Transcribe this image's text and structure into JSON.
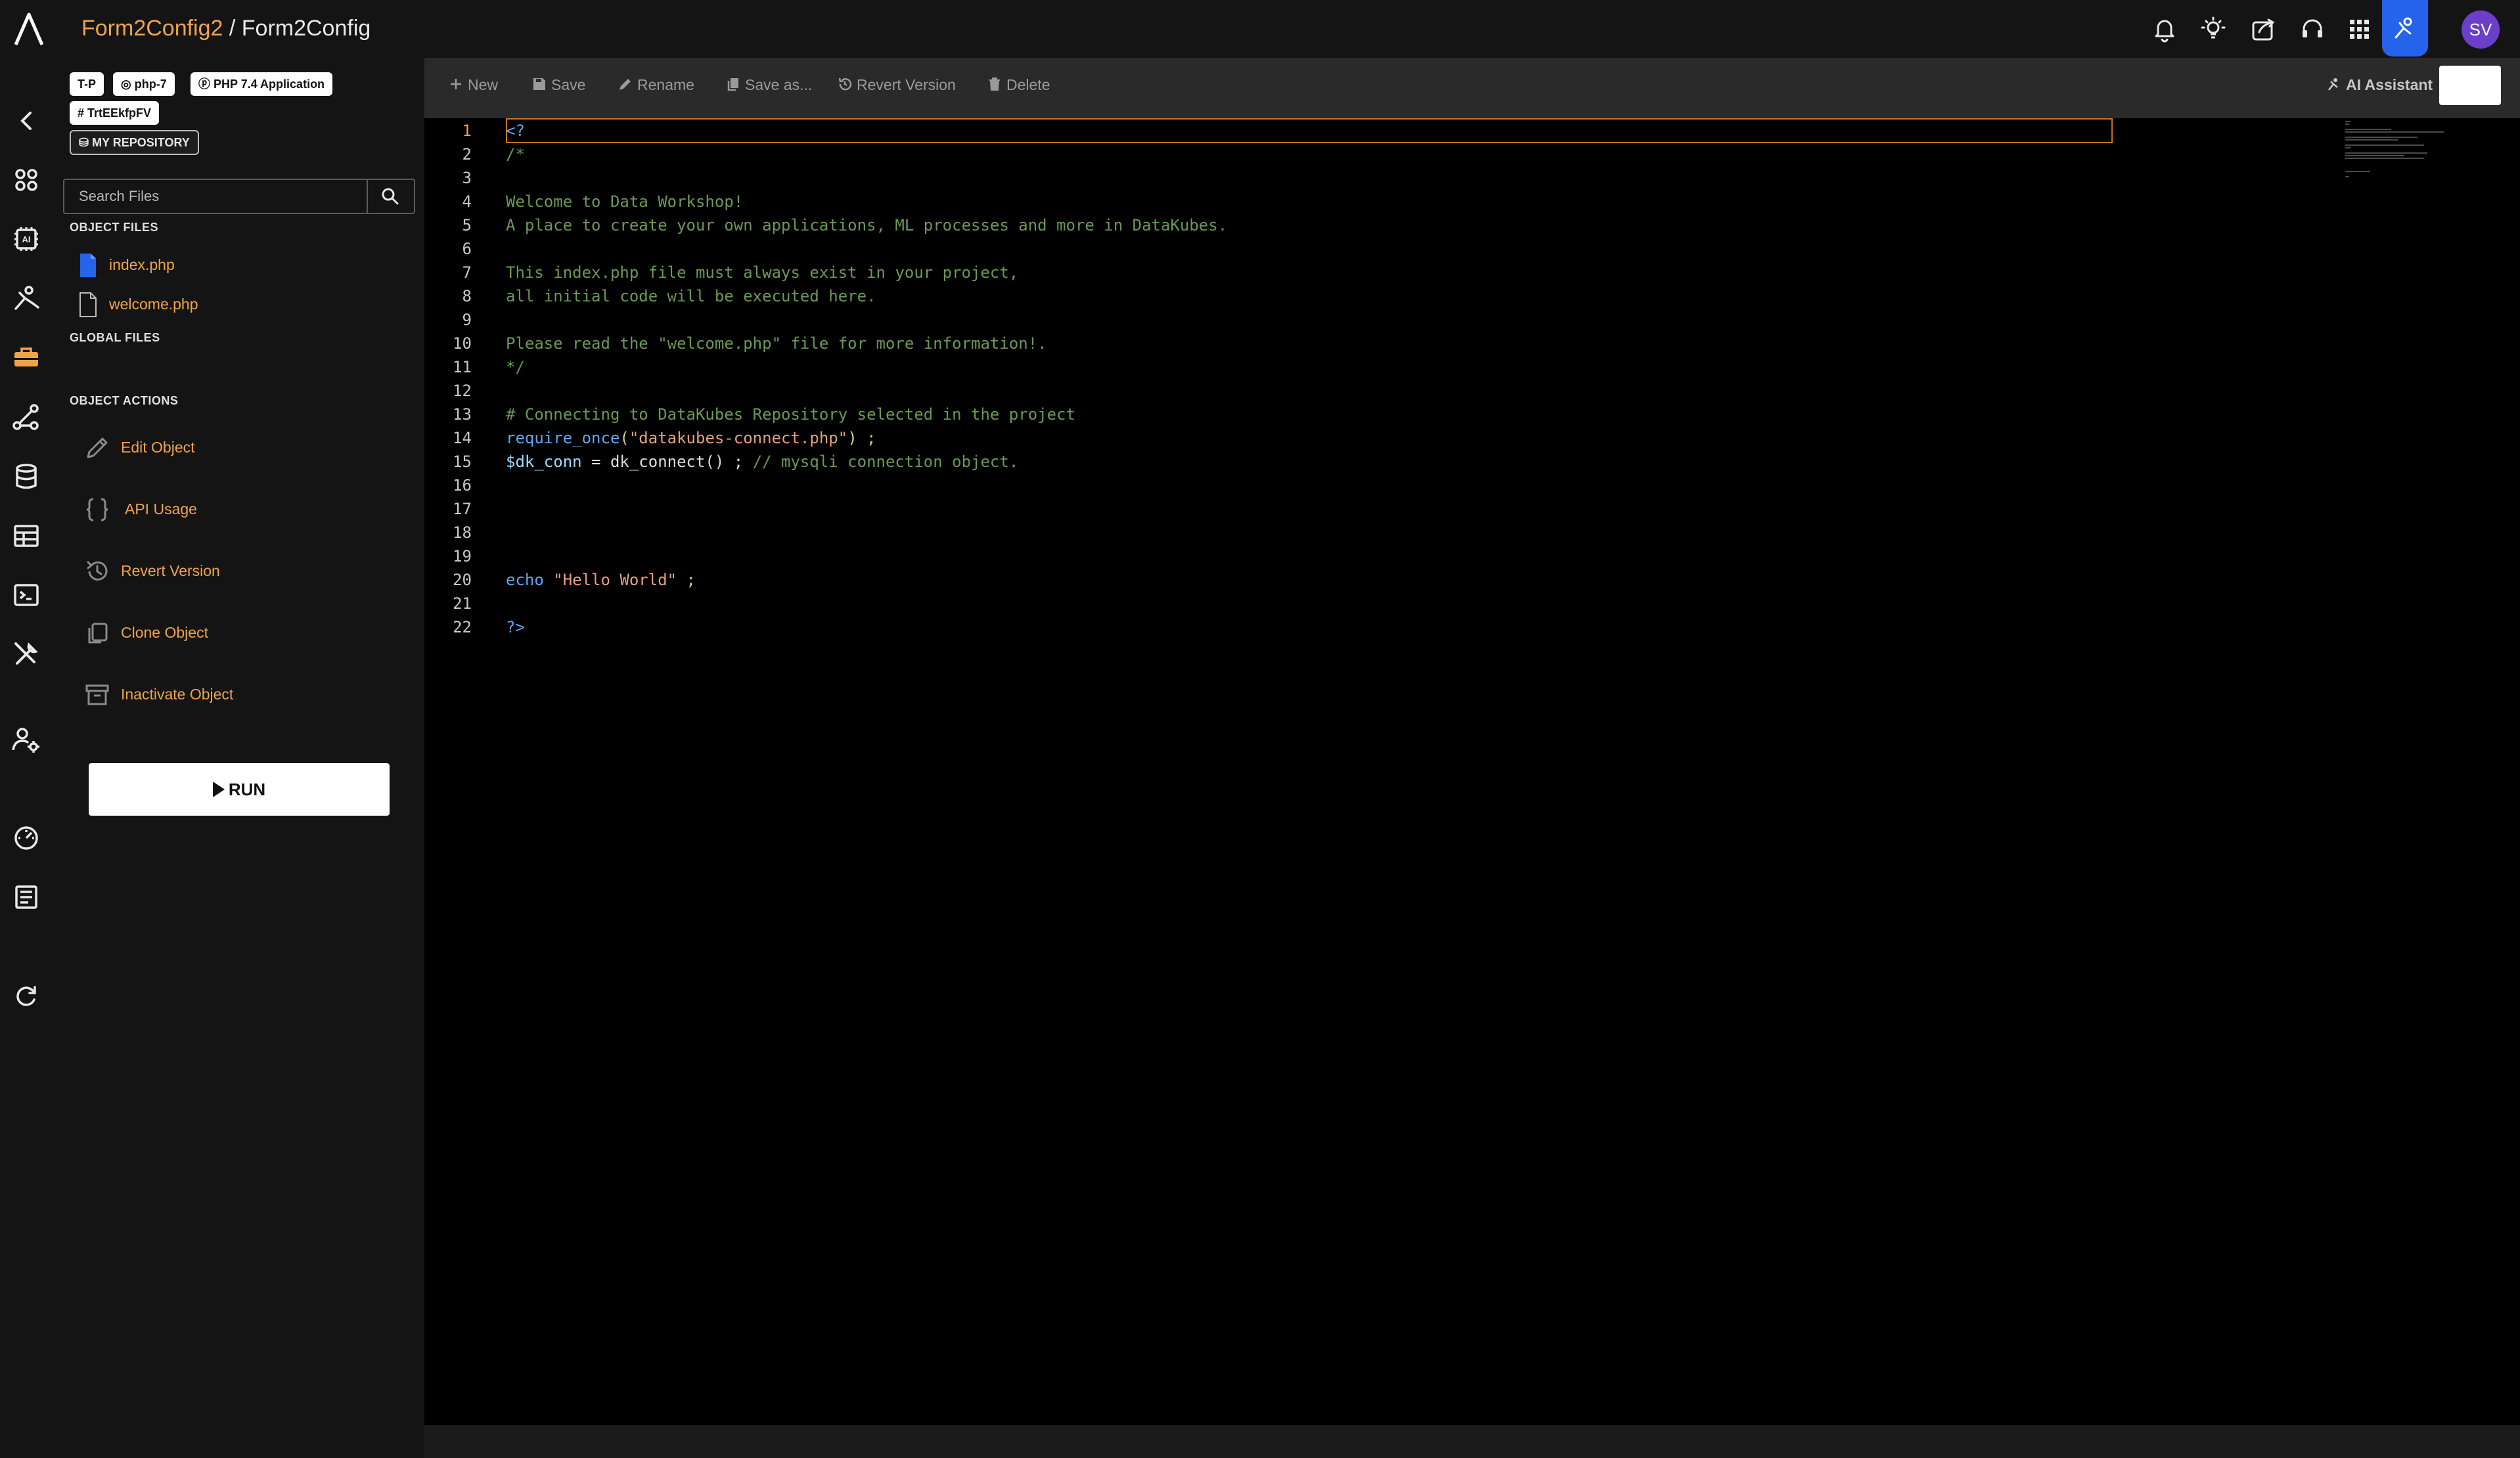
{
  "breadcrumb": {
    "parent": "Form2Config2",
    "separator": " / ",
    "current": "Form2Config"
  },
  "header_icons": [
    "bell-icon",
    "lightbulb-icon",
    "share-icon",
    "support-icon",
    "apps-grid-icon",
    "ai-agent-icon"
  ],
  "user": {
    "initials": "SV"
  },
  "tags": {
    "t1": "T-P",
    "t2": "php-7",
    "t3": "PHP 7.4 Application",
    "t4": "TrtEEkfpFV",
    "repo": "MY REPOSITORY"
  },
  "search": {
    "placeholder": "Search Files"
  },
  "sections": {
    "object_files": "OBJECT FILES",
    "global_files": "GLOBAL FILES",
    "object_actions": "OBJECT ACTIONS"
  },
  "files": [
    {
      "name": "index.php",
      "active": true
    },
    {
      "name": "welcome.php",
      "active": false
    }
  ],
  "actions": {
    "edit": "Edit Object",
    "api": "API Usage",
    "revert": "Revert Version",
    "clone": "Clone Object",
    "inactivate": "Inactivate Object"
  },
  "run_label": "RUN",
  "toolbar": {
    "new": "New",
    "save": "Save",
    "rename": "Rename",
    "save_as": "Save as...",
    "revert": "Revert Version",
    "delete": "Delete",
    "ai": "AI Assistant"
  },
  "code": {
    "line_numbers": [
      "1",
      "2",
      "3",
      "4",
      "5",
      "6",
      "7",
      "8",
      "9",
      "10",
      "11",
      "12",
      "13",
      "14",
      "15",
      "16",
      "17",
      "18",
      "19",
      "20",
      "21",
      "22"
    ],
    "l1": "<?",
    "l2": "/*",
    "l4": "Welcome to Data Workshop!",
    "l5": "A place to create your own applications, ML processes and more in DataKubes.",
    "l7": "This index.php file must always exist in your project,",
    "l8": "all initial code will be executed here.",
    "l10": "Please read the \"welcome.php\" file for more information!.",
    "l11": "*/",
    "l13": "# Connecting to DataKubes Repository selected in the project",
    "l14_fn": "require_once",
    "l14_open": "(",
    "l14_str": "\"datakubes-connect.php\"",
    "l14_close": ") ;",
    "l15_var": "$dk_conn",
    "l15_op": " = dk_connect() ; ",
    "l15_cm": "// mysqli connection object.",
    "l20_kw": "echo",
    "l20_str": "\"Hello World\"",
    "l20_end": " ;",
    "l22": "?>"
  },
  "colors": {
    "accent": "#f0a44a",
    "active_blue": "#2563eb",
    "avatar": "#6b3fc9"
  }
}
